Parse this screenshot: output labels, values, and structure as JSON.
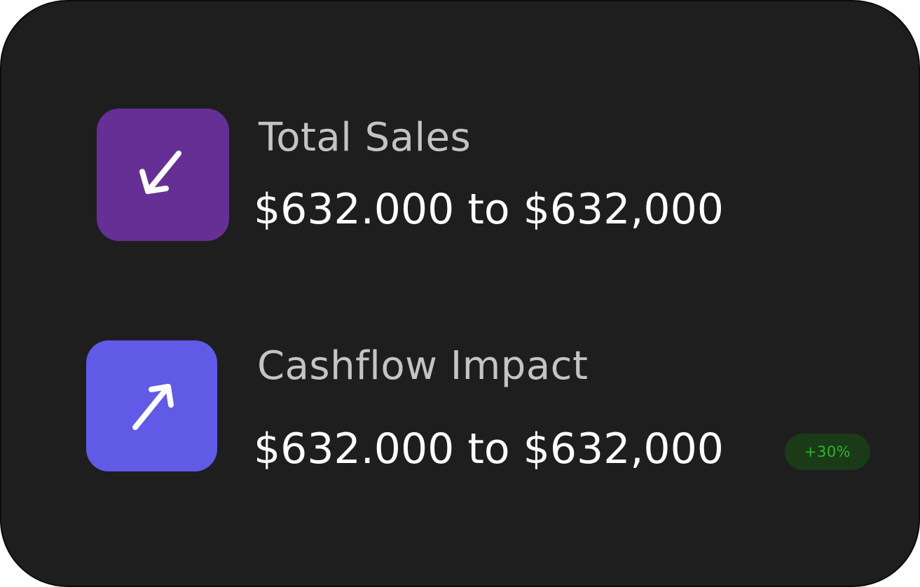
{
  "colors": {
    "card_background": "#1e1e1e",
    "sales_tile": "#662f95",
    "cashflow_tile": "#615ae7",
    "label_text": "#c4c4c4",
    "value_text": "#ffffff",
    "badge_background": "#1a3a18",
    "badge_text": "#2fb52a"
  },
  "metrics": [
    {
      "label": "Total Sales",
      "value": "$632.000 to $632,000",
      "icon": "arrow-down-left-icon"
    },
    {
      "label": "Cashflow Impact",
      "value": "$632.000 to $632,000",
      "icon": "arrow-up-right-icon",
      "badge": "+30%"
    }
  ]
}
